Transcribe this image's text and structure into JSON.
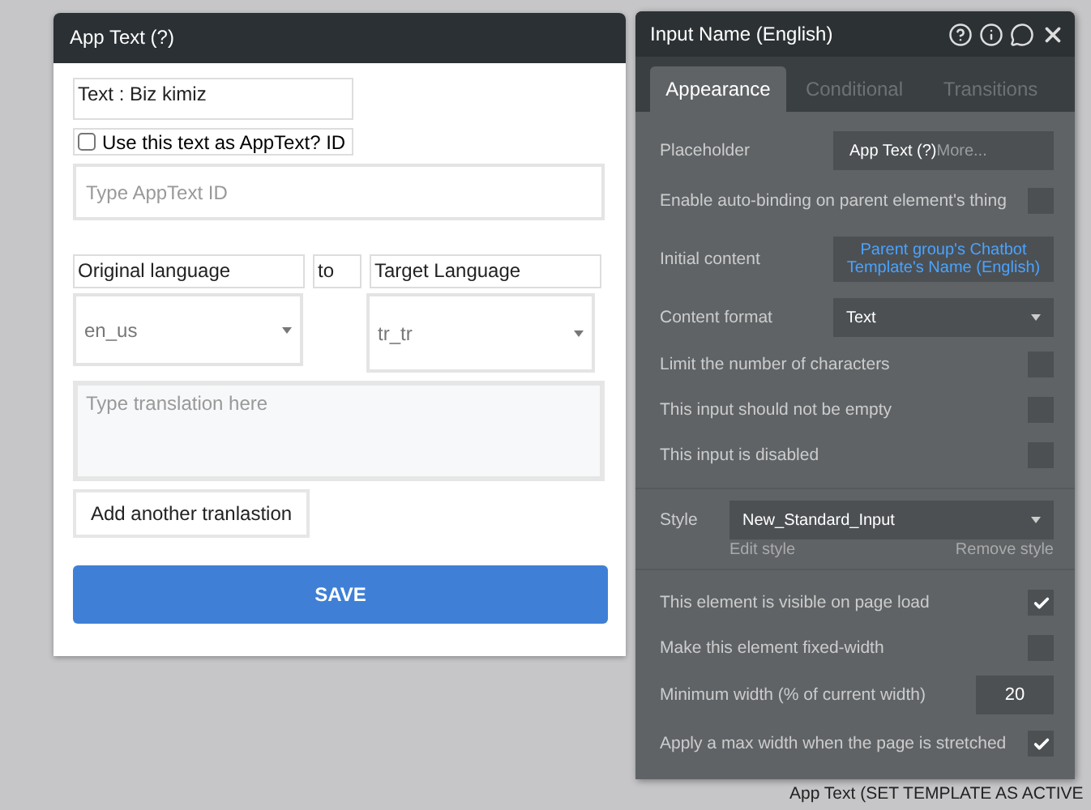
{
  "background": {
    "status_text": "App Text (SET TEMPLATE AS ACTIVE"
  },
  "dialog": {
    "title": "App Text (?)",
    "text_label": "Text : Biz kimiz",
    "use_id_checkbox": {
      "label": "Use this text as AppText? ID",
      "checked": false
    },
    "id_input": {
      "placeholder": "Type AppText ID"
    },
    "original_label": "Original language",
    "to_label": "to",
    "target_label": "Target Language",
    "original_select": {
      "value": "en_us"
    },
    "target_select": {
      "value": "tr_tr"
    },
    "translation": {
      "placeholder": "Type translation here"
    },
    "add_button": "Add another tranlastion",
    "save_button": "SAVE"
  },
  "inspector": {
    "title": "Input Name (English)",
    "tabs": [
      {
        "label": "Appearance",
        "selected": true
      },
      {
        "label": "Conditional",
        "selected": false
      },
      {
        "label": "Transitions",
        "selected": false
      }
    ],
    "rows": [
      {
        "kind": "text",
        "label": "Placeholder",
        "value": "App Text (?)",
        "hint": "More..."
      },
      {
        "kind": "checkbox",
        "label": "Enable auto-binding on parent element's thing",
        "checked": false
      },
      {
        "kind": "dynamic",
        "label": "Initial content",
        "value": "Parent group's Chatbot Template's Name (English)"
      },
      {
        "kind": "select",
        "label": "Content format",
        "value": "Text"
      },
      {
        "kind": "checkbox",
        "label": "Limit the number of characters",
        "checked": false
      },
      {
        "kind": "checkbox",
        "label": "This input should not be empty",
        "checked": false
      },
      {
        "kind": "checkbox",
        "label": "This input is disabled",
        "checked": false
      },
      {
        "kind": "style",
        "label": "Style",
        "value": "New_Standard_Input",
        "edit": "Edit style",
        "remove": "Remove style"
      },
      {
        "kind": "checkbox",
        "label": "This element is visible on page load",
        "checked": true
      },
      {
        "kind": "checkbox",
        "label": "Make this element fixed-width",
        "checked": false
      },
      {
        "kind": "number",
        "label": "Minimum width (% of current width)",
        "value": "20"
      },
      {
        "kind": "checkbox",
        "label": "Apply a max width when the page is stretched",
        "checked": true
      }
    ]
  }
}
